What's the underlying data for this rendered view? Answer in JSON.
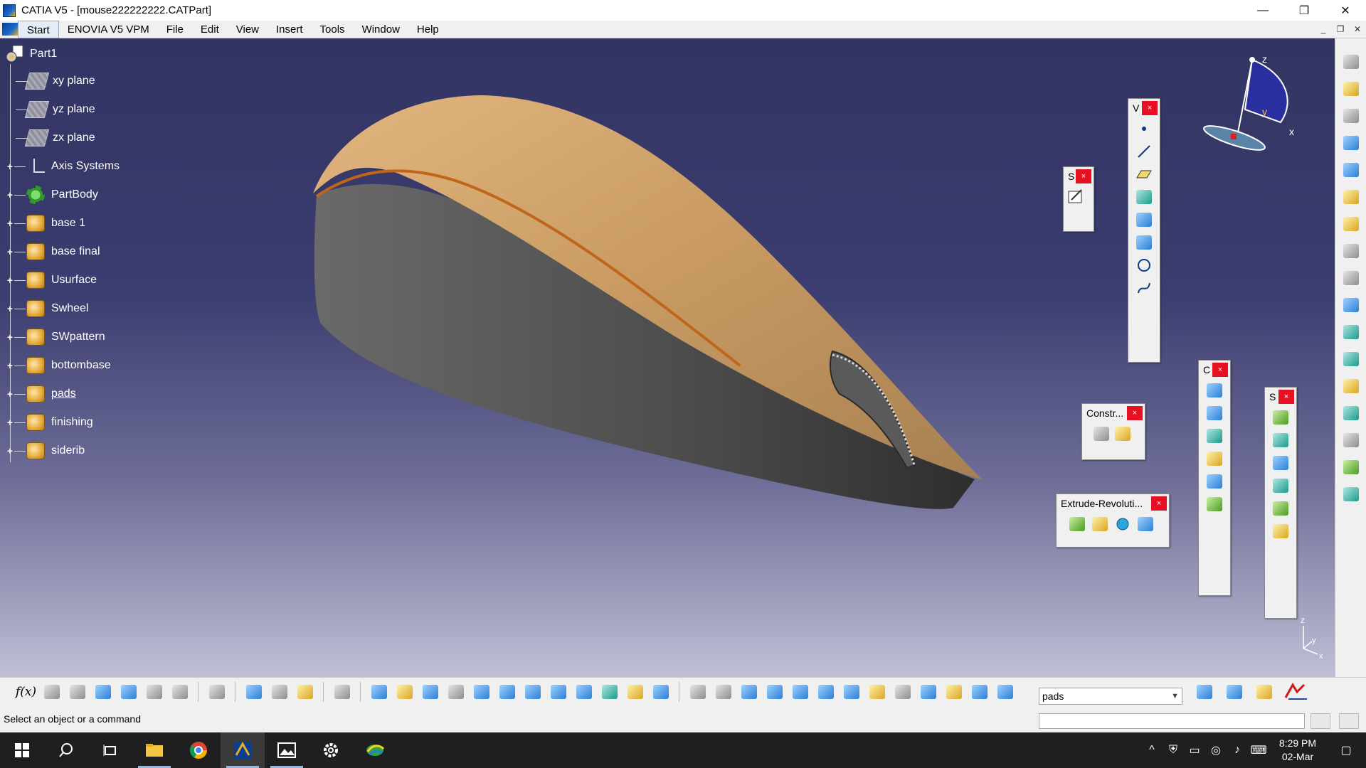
{
  "window": {
    "title": "CATIA V5 - [mouse222222222.CATPart]",
    "minimize": "—",
    "maximize": "❐",
    "close": "✕"
  },
  "menu": {
    "items": [
      "Start",
      "ENOVIA V5 VPM",
      "File",
      "Edit",
      "View",
      "Insert",
      "Tools",
      "Window",
      "Help"
    ],
    "mdi_minimize": "_",
    "mdi_restore": "❐",
    "mdi_close": "✕"
  },
  "tree": {
    "root": "Part1",
    "items": [
      {
        "label": "xy plane",
        "icon": "plane-icon"
      },
      {
        "label": "yz plane",
        "icon": "plane-icon"
      },
      {
        "label": "zx plane",
        "icon": "plane-icon"
      },
      {
        "label": "Axis Systems",
        "icon": "axis-system-icon"
      },
      {
        "label": "PartBody",
        "icon": "partbody-gear-icon"
      },
      {
        "label": "base 1",
        "icon": "geometrical-set-icon"
      },
      {
        "label": "base final",
        "icon": "geometrical-set-icon"
      },
      {
        "label": "Usurface",
        "icon": "geometrical-set-icon"
      },
      {
        "label": "Swheel",
        "icon": "geometrical-set-icon"
      },
      {
        "label": "SWpattern",
        "icon": "geometrical-set-icon"
      },
      {
        "label": "bottombase",
        "icon": "geometrical-set-icon"
      },
      {
        "label": "pads",
        "icon": "geometrical-set-icon"
      },
      {
        "label": "finishing",
        "icon": "geometrical-set-icon"
      },
      {
        "label": "siderib",
        "icon": "geometrical-set-icon"
      }
    ]
  },
  "toolbars": {
    "wireframe": {
      "title": "V"
    },
    "sketcher": {
      "title": "S"
    },
    "constraints": {
      "title": "Constr..."
    },
    "extrude": {
      "title": "Extrude-Revoluti..."
    },
    "operations": {
      "title": "C"
    },
    "surfaces": {
      "title": "S"
    },
    "close_label": "×"
  },
  "compass": {
    "z": "z",
    "x": "x",
    "y": "y"
  },
  "mini_axis": {
    "z": "z",
    "y": "y",
    "x": "x"
  },
  "current_selection": "pads",
  "status_text": "Select an object or a command",
  "clock": {
    "time": "8:29 PM",
    "date": "02-Mar"
  },
  "colors": {
    "viewport_top": "#323462",
    "viewport_bottom": "#bfbfd6",
    "model_top": "#c89a62",
    "model_side": "#4a4a4a",
    "model_edge": "#c0661a",
    "close_red": "#e81123"
  }
}
